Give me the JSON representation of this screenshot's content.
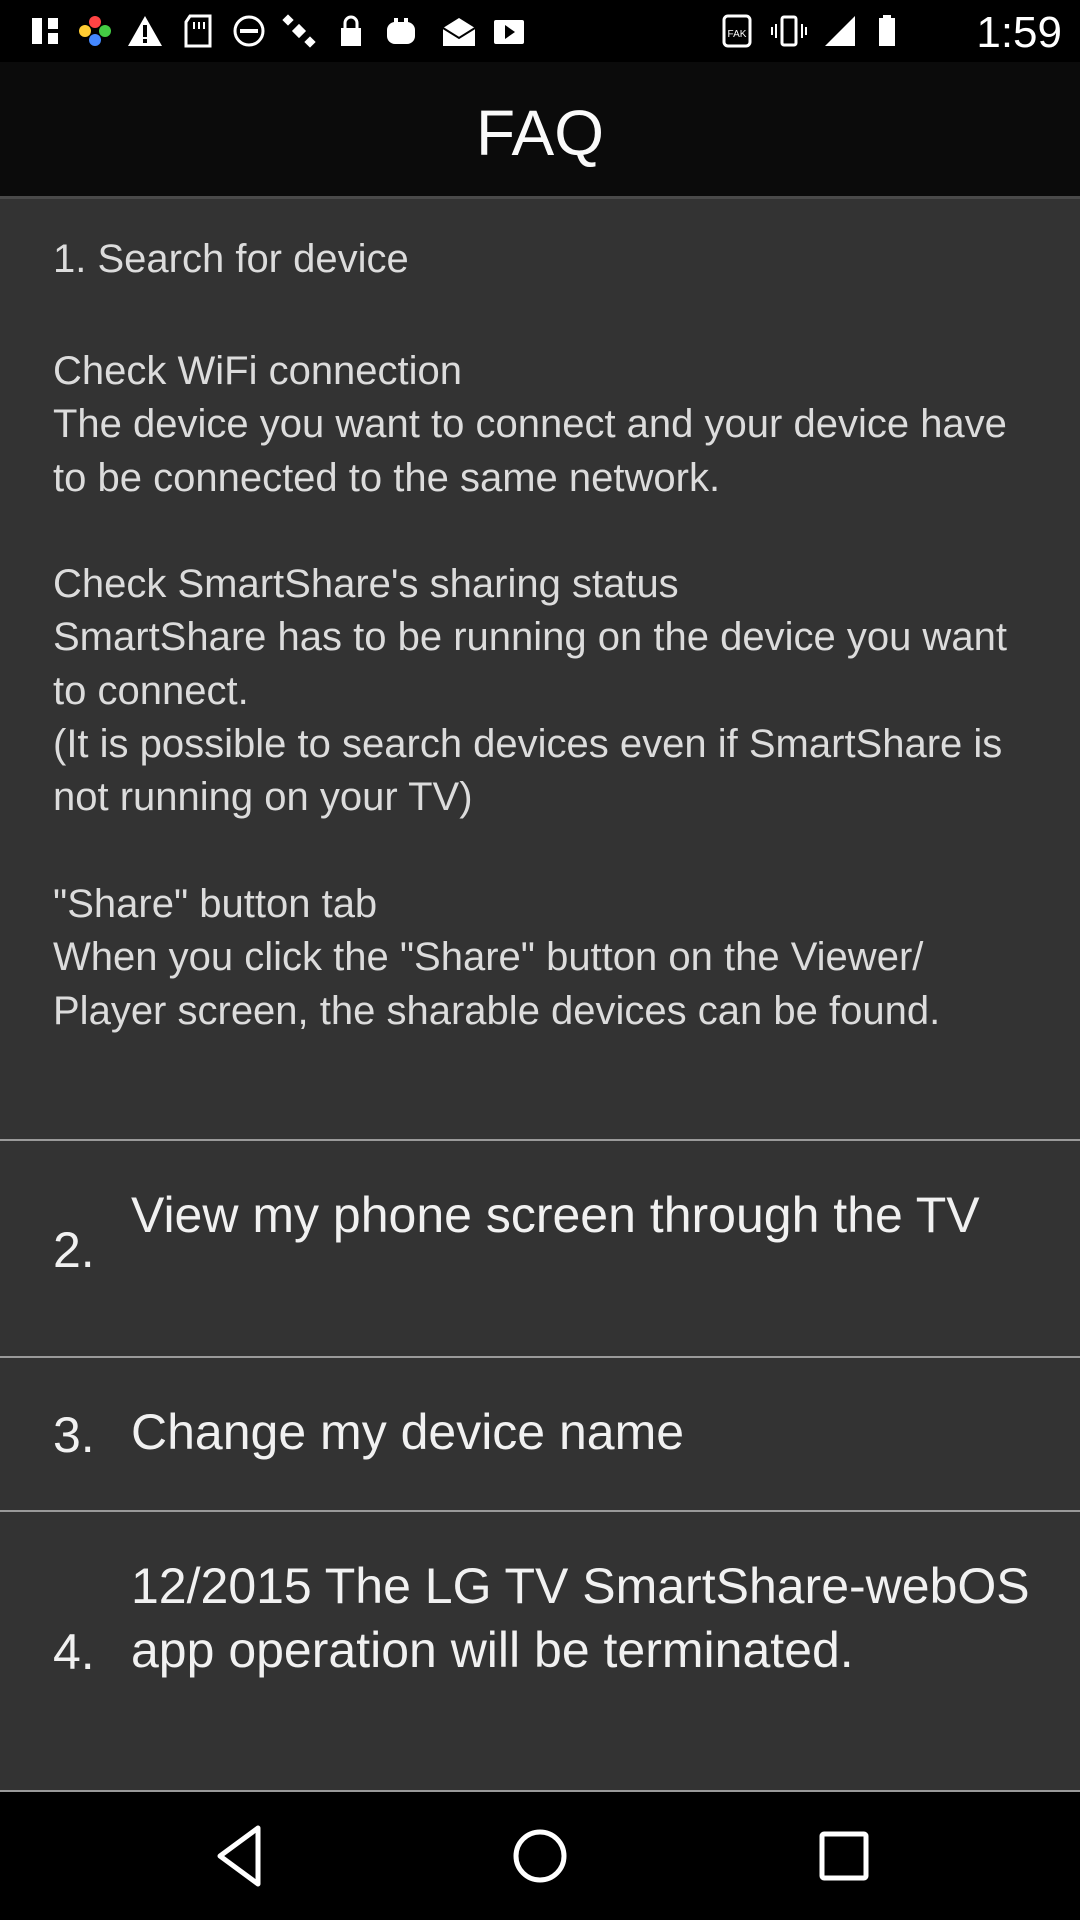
{
  "status_bar": {
    "time": "1:59",
    "left_icons": [
      "flip-icon",
      "pinwheel-icon",
      "warning-icon",
      "sd-card-icon",
      "block-icon",
      "satellite-icon",
      "lock-icon",
      "toaster-icon",
      "mail-open-icon",
      "play-store-icon"
    ],
    "right_icons": [
      "nfc-icon",
      "vibrate-icon",
      "no-signal-icon",
      "battery-icon"
    ]
  },
  "app_bar": {
    "title": "FAQ"
  },
  "faq": {
    "item1": {
      "title": "1. Search for device",
      "body": "Check WiFi connection\nThe device you want to connect and your device have to be connected to the same network.\n\nCheck SmartShare's sharing status\nSmartShare has to be running on the device you want to connect.\n(It is possible to search devices even if SmartShare is not running on your TV)\n\n\"Share\" button tab\nWhen you click the \"Share\" button on the Viewer/ Player screen, the sharable devices can be found."
    },
    "items": [
      {
        "number": "2.",
        "text": "View my phone screen through the TV"
      },
      {
        "number": "3.",
        "text": "Change my device name"
      },
      {
        "number": "4.",
        "text": "12/2015 The LG TV SmartShare-webOS app operation will be terminated."
      }
    ]
  },
  "nav_bar": {
    "buttons": [
      "back-icon",
      "home-icon",
      "recents-icon"
    ]
  }
}
